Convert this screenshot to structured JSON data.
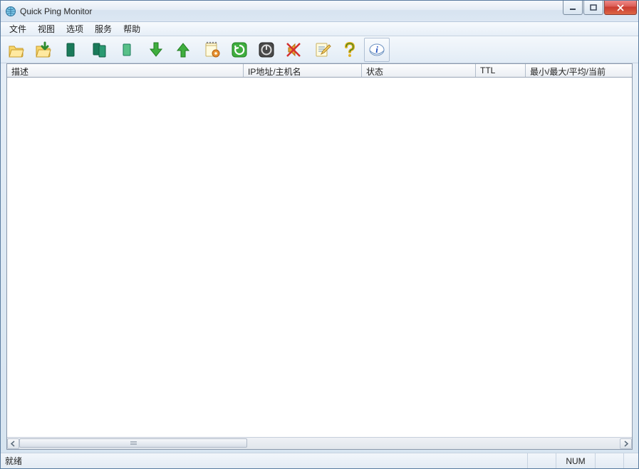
{
  "window": {
    "title": "Quick Ping Monitor"
  },
  "menu": {
    "file": "文件",
    "view": "视图",
    "options": "选项",
    "service": "服务",
    "help": "帮助"
  },
  "toolbar": {
    "icons": [
      "open-folder-icon",
      "save-folder-icon",
      "new-item-icon",
      "copy-items-icon",
      "single-item-icon",
      "arrow-down-icon",
      "arrow-up-icon",
      "notes-gear-icon",
      "refresh-green-icon",
      "stop-icon",
      "mute-icon",
      "edit-note-icon",
      "help-icon",
      "info-icon"
    ]
  },
  "columns": {
    "description": "描述",
    "ip_host": "IP地址/主机名",
    "status": "状态",
    "ttl": "TTL",
    "stats": "最小/最大/平均/当前"
  },
  "column_widths": {
    "description": 332,
    "ip_host": 166,
    "status": 160,
    "ttl": 70,
    "stats": 150
  },
  "rows": [],
  "statusbar": {
    "ready": "就绪",
    "num": "NUM"
  }
}
